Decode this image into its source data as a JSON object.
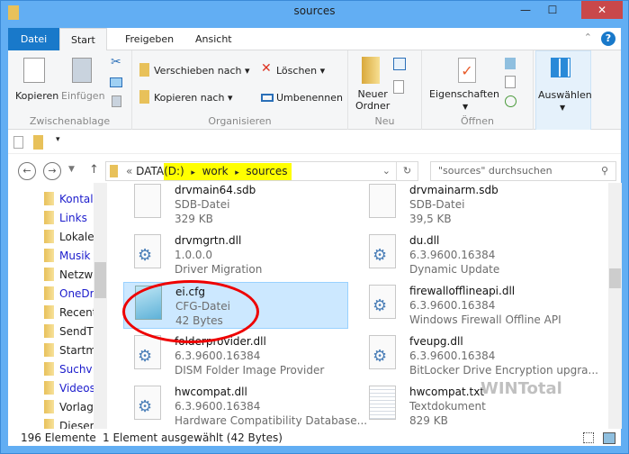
{
  "window": {
    "title": "sources",
    "minimize": "—",
    "maximize": "☐",
    "close": "✕"
  },
  "tabs": [
    "Datei",
    "Start",
    "Freigeben",
    "Ansicht"
  ],
  "ribbon": {
    "clipboard": {
      "label": "Zwischenablage",
      "copy": "Kopieren",
      "paste": "Einfügen"
    },
    "organize": {
      "label": "Organisieren",
      "move": "Verschieben nach",
      "copyto": "Kopieren nach",
      "delete": "Löschen",
      "rename": "Umbenennen"
    },
    "new": {
      "label": "Neu",
      "newfolder1": "Neuer",
      "newfolder2": "Ordner"
    },
    "open": {
      "label": "Öffnen",
      "properties": "Eigenschaften"
    },
    "select": {
      "label": "Auswählen"
    }
  },
  "address": {
    "prefix": "«",
    "segments": [
      "DATA",
      "(D:)",
      "work",
      "sources"
    ],
    "sep": "▸"
  },
  "search": {
    "placeholder": "\"sources\" durchsuchen"
  },
  "nav": [
    "Kontal",
    "Links",
    "Lokale",
    "Musik",
    "Netzw",
    "OneDr",
    "Recent",
    "SendT",
    "Startm",
    "Suchv",
    "Videos",
    "Vorlag",
    "Dieser P"
  ],
  "files": [
    {
      "name": "drvmain64.sdb",
      "l2": "SDB-Datei",
      "l3": "329 KB",
      "type": "blank"
    },
    {
      "name": "drvmainarm.sdb",
      "l2": "SDB-Datei",
      "l3": "39,5 KB",
      "type": "blank"
    },
    {
      "name": "drvmgrtn.dll",
      "l2": "1.0.0.0",
      "l3": "Driver Migration",
      "type": "dll"
    },
    {
      "name": "du.dll",
      "l2": "6.3.9600.16384",
      "l3": "Dynamic Update",
      "type": "dll"
    },
    {
      "name": "ei.cfg",
      "l2": "CFG-Datei",
      "l3": "42 Bytes",
      "type": "cfg",
      "selected": true
    },
    {
      "name": "firewallofflineapi.dll",
      "l2": "6.3.9600.16384",
      "l3": "Windows Firewall Offline API",
      "type": "dll"
    },
    {
      "name": "folderprovider.dll",
      "l2": "6.3.9600.16384",
      "l3": "DISM Folder Image Provider",
      "type": "dll"
    },
    {
      "name": "fveupg.dll",
      "l2": "6.3.9600.16384",
      "l3": "BitLocker Drive Encryption upgra...",
      "type": "dll"
    },
    {
      "name": "hwcompat.dll",
      "l2": "6.3.9600.16384",
      "l3": "Hardware Compatibility Database...",
      "type": "dll"
    },
    {
      "name": "hwcompat.txt",
      "l2": "Textdokument",
      "l3": "829 KB",
      "type": "txt"
    }
  ],
  "status": {
    "count": "196 Elemente",
    "selection": "1 Element ausgewählt (42 Bytes)"
  },
  "watermark": "WINTotal",
  "colors": {
    "accent": "#1979ca",
    "selection": "#cce8ff",
    "highlight": "#ffff00",
    "annotation": "#e00000"
  }
}
